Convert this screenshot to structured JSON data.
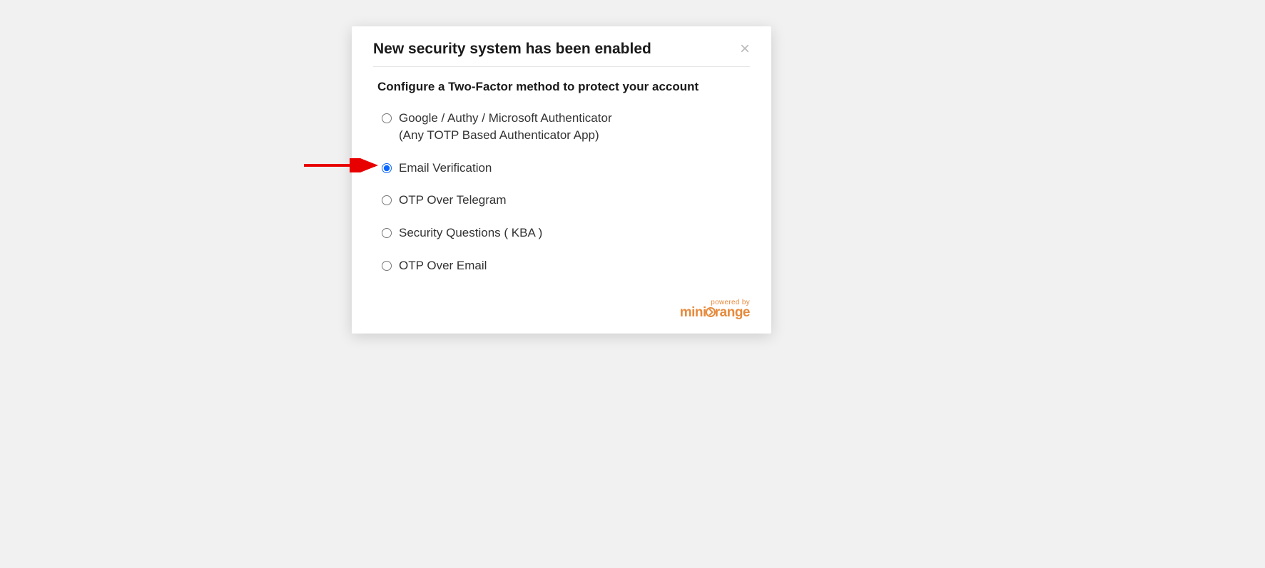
{
  "modal": {
    "title": "New security system has been enabled",
    "subtitle": "Configure a Two-Factor method to protect your account",
    "options": [
      {
        "label": "Google / Authy / Microsoft Authenticator",
        "sublabel": "(Any TOTP Based Authenticator App)",
        "selected": false
      },
      {
        "label": "Email Verification",
        "sublabel": "",
        "selected": true
      },
      {
        "label": "OTP Over Telegram",
        "sublabel": "",
        "selected": false
      },
      {
        "label": "Security Questions ( KBA )",
        "sublabel": "",
        "selected": false
      },
      {
        "label": "OTP Over Email",
        "sublabel": "",
        "selected": false
      }
    ]
  },
  "footer": {
    "powered_by": "powered by",
    "brand_prefix": "mini",
    "brand_suffix": "range"
  },
  "annotation": {
    "arrow_target_index": 1
  }
}
